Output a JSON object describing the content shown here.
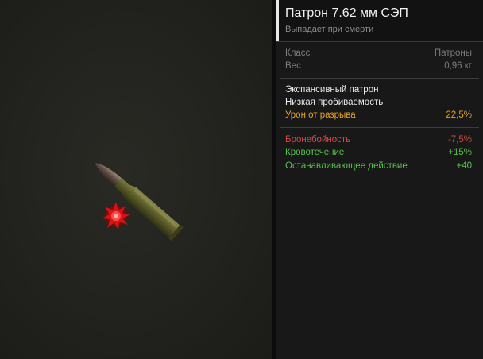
{
  "item": {
    "title": "Патрон 7.62 мм СЭП",
    "subtitle": "Выпадает при смерти",
    "icon": "cartridge-icon"
  },
  "stats": [
    {
      "label": "Класс",
      "value": "Патроны"
    },
    {
      "label": "Вес",
      "value": "0,96 кг"
    }
  ],
  "description": {
    "line1": "Экспансивный патрон",
    "line2": "Низкая пробиваемость",
    "bonus_label": "Урон от разрыва",
    "bonus_value": "22,5%"
  },
  "modifiers": [
    {
      "label": "Бронебойность",
      "value": "-7,5%",
      "color": "#d24a42"
    },
    {
      "label": "Кровотечение",
      "value": "+15%",
      "color": "#57c24d"
    },
    {
      "label": "Останавливающее действие",
      "value": "+40",
      "color": "#57c24d"
    }
  ],
  "colors": {
    "accent": "#e9a126",
    "negative": "#d24a42",
    "positive": "#57c24d"
  }
}
